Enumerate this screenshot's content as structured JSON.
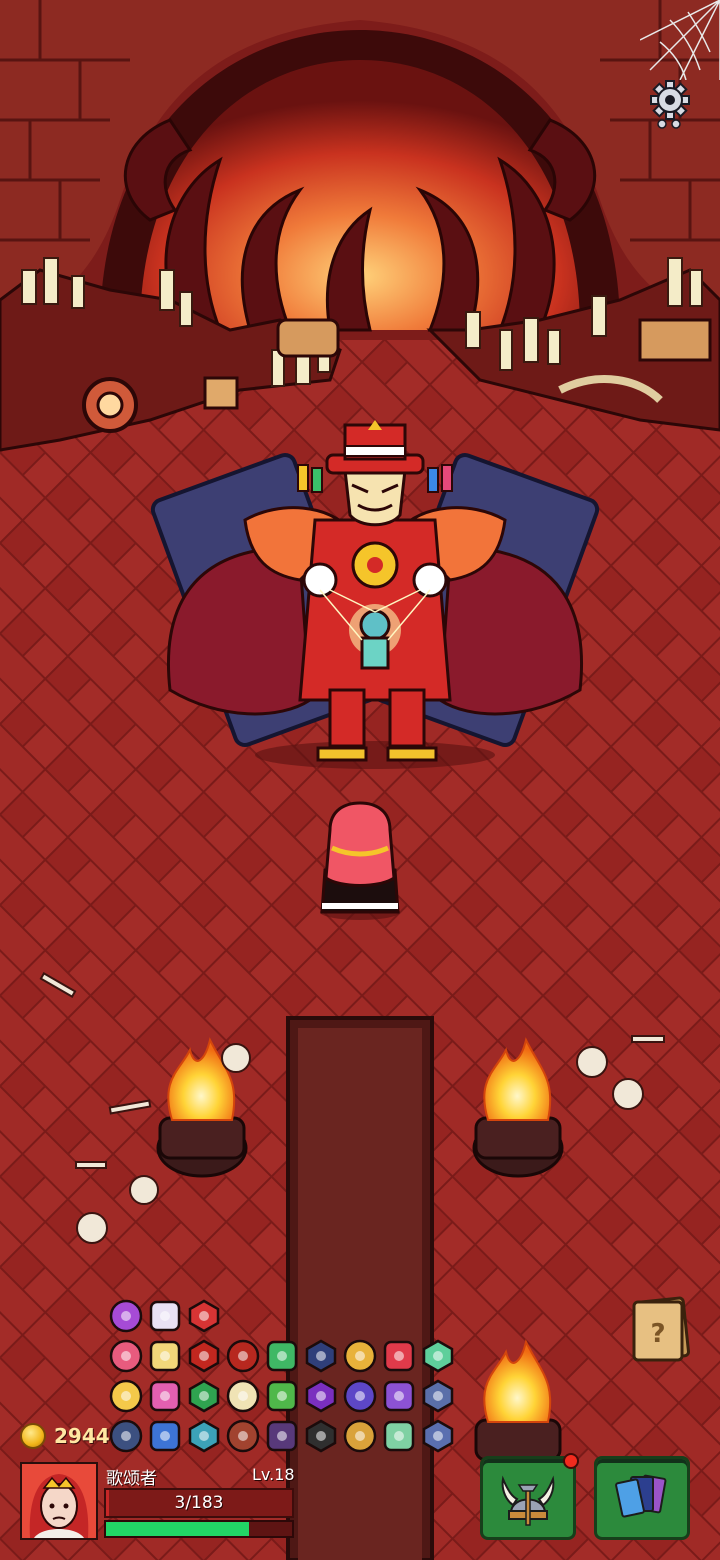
{
  "hud": {
    "gold": "2944",
    "player_name": "歌颂者",
    "level": "Lv.18",
    "hp_text": "3/183",
    "hp_fraction": 0.016,
    "xp_fraction": 0.77
  },
  "icons": {
    "settings": "gear-icon",
    "hint": "question-card-icon",
    "equipment": "viking-helmet-tools-icon",
    "cards": "card-deck-icon",
    "coin": "gold-coin-icon"
  },
  "colors": {
    "floor": "#9a2623",
    "hp": "#c72727",
    "xp": "#22d666",
    "button": "#2c8a3c",
    "gold_text": "#ffe7a3"
  },
  "inventory": [
    "purple-flower-relic",
    "clock-rune-relic",
    "fang-mouth-relic",
    "heart-lock-relic",
    "potion-flask-relic",
    "demon-face-relic",
    "horn-relic",
    "green-triangle-relic",
    "pentagon-gem-relic",
    "hourglass-relic",
    "red-heart-card-relic",
    "spiky-orb-relic",
    "gold-star-relic",
    "pink-demon-relic",
    "green-shell-relic",
    "bone-relic",
    "green-lizard-relic",
    "question-rune-relic",
    "purple-blob-relic",
    "shield-rune-relic",
    "blue-hex-relic",
    "ghost-relic",
    "blue-sword-relic",
    "mushroom-relic",
    "crate-relic",
    "bat-relic",
    "witch-hat-relic",
    "lock-chest-relic",
    "green-jar-relic",
    "fist-rune-relic"
  ]
}
